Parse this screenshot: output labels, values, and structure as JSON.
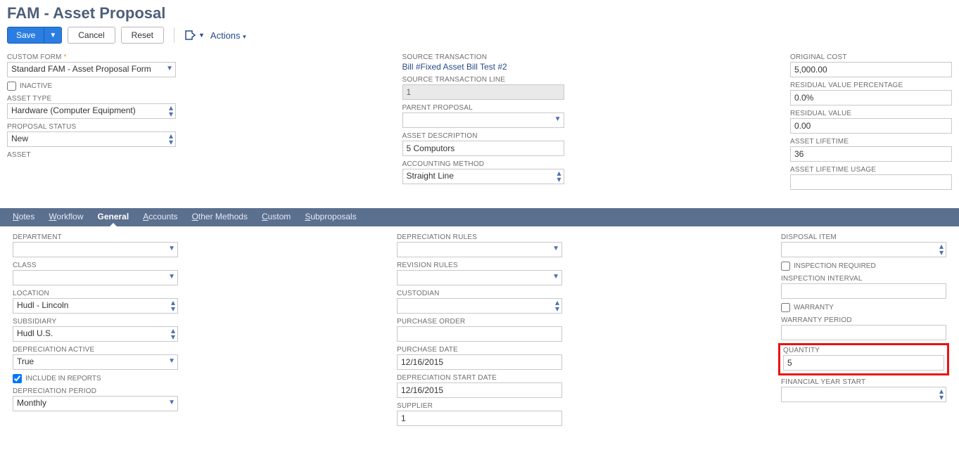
{
  "page_title": "FAM - Asset Proposal",
  "toolbar": {
    "save": "Save",
    "cancel": "Cancel",
    "reset": "Reset",
    "actions": "Actions"
  },
  "main": {
    "custom_form_label": "CUSTOM FORM",
    "custom_form_value": "Standard FAM - Asset Proposal Form",
    "inactive_label": "INACTIVE",
    "asset_type_label": "ASSET TYPE",
    "asset_type_value": "Hardware (Computer Equipment)",
    "proposal_status_label": "PROPOSAL STATUS",
    "proposal_status_value": "New",
    "asset_label": "ASSET",
    "source_txn_label": "SOURCE TRANSACTION",
    "source_txn_link": "Bill #Fixed Asset Bill Test #2",
    "source_txn_line_label": "SOURCE TRANSACTION LINE",
    "source_txn_line_value": "1",
    "parent_proposal_label": "PARENT PROPOSAL",
    "parent_proposal_value": "",
    "asset_desc_label": "ASSET DESCRIPTION",
    "asset_desc_value": "5 Computors",
    "acct_method_label": "ACCOUNTING METHOD",
    "acct_method_value": "Straight Line",
    "orig_cost_label": "ORIGINAL COST",
    "orig_cost_value": "5,000.00",
    "resid_pct_label": "RESIDUAL VALUE PERCENTAGE",
    "resid_pct_value": "0.0%",
    "resid_val_label": "RESIDUAL VALUE",
    "resid_val_value": "0.00",
    "asset_life_label": "ASSET LIFETIME",
    "asset_life_value": "36",
    "asset_life_usage_label": "ASSET LIFETIME USAGE",
    "asset_life_usage_value": ""
  },
  "tabs": {
    "notes": "Notes",
    "workflow": "Workflow",
    "general": "General",
    "accounts": "Accounts",
    "other_methods": "Other Methods",
    "custom": "Custom",
    "subproposals": "Subproposals"
  },
  "general": {
    "department_label": "DEPARTMENT",
    "department_value": "",
    "class_label": "CLASS",
    "class_value": "",
    "location_label": "LOCATION",
    "location_value": "Hudl - Lincoln",
    "subsidiary_label": "SUBSIDIARY",
    "subsidiary_value": "Hudl U.S.",
    "depr_active_label": "DEPRECIATION ACTIVE",
    "depr_active_value": "True",
    "include_reports_label": "INCLUDE IN REPORTS",
    "depr_period_label": "DEPRECIATION PERIOD",
    "depr_period_value": "Monthly",
    "depr_rules_label": "DEPRECIATION RULES",
    "revision_rules_label": "REVISION RULES",
    "custodian_label": "CUSTODIAN",
    "po_label": "PURCHASE ORDER",
    "purchase_date_label": "PURCHASE DATE",
    "purchase_date_value": "12/16/2015",
    "depr_start_label": "DEPRECIATION START DATE",
    "depr_start_value": "12/16/2015",
    "supplier_label": "SUPPLIER",
    "supplier_value": "1",
    "disposal_item_label": "DISPOSAL ITEM",
    "inspection_req_label": "INSPECTION REQUIRED",
    "inspection_int_label": "INSPECTION INTERVAL",
    "warranty_label": "WARRANTY",
    "warranty_period_label": "WARRANTY PERIOD",
    "quantity_label": "QUANTITY",
    "quantity_value": "5",
    "fy_start_label": "FINANCIAL YEAR START"
  }
}
